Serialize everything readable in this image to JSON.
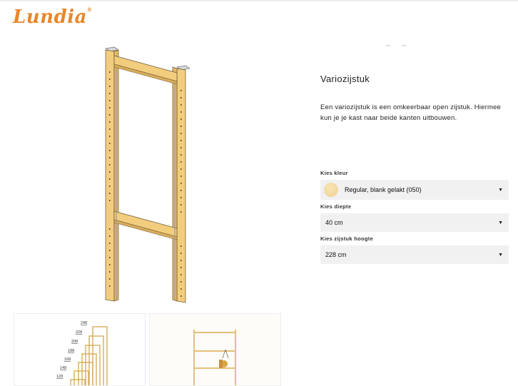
{
  "brand": {
    "logo_text": "Lundia",
    "trademark": "®"
  },
  "product": {
    "title": "Variozijstuk",
    "description": "Een variozijstuk is een omkeerbaar open zijstuk. Hiermee kun je je kast naar beide kanten uitbouwen."
  },
  "options": {
    "color": {
      "label": "Kies kleur",
      "value": "Regular, blank gelakt (050)",
      "swatch_color": "#f3dca6"
    },
    "depth": {
      "label": "Kies diepte",
      "value": "40 cm"
    },
    "height": {
      "label": "Kies zijstuk hoogte",
      "value": "228 cm"
    }
  },
  "thumbnails": {
    "heights": [
      "248",
      "228",
      "208",
      "188",
      "168",
      "148",
      "128"
    ]
  },
  "colors": {
    "brand_orange": "#e8872a",
    "wood": "#f2cd7e",
    "select_bg": "#f1f1f1"
  }
}
